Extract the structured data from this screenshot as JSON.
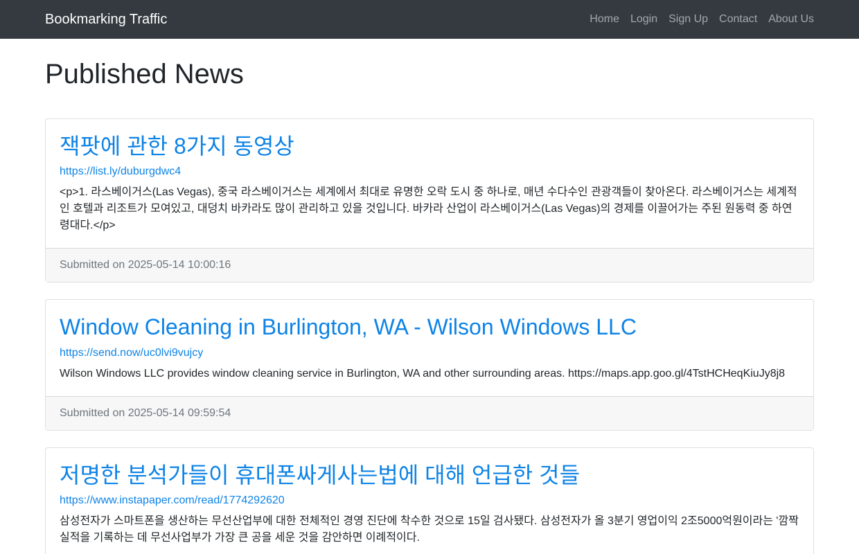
{
  "navbar": {
    "brand": "Bookmarking Traffic",
    "links": [
      "Home",
      "Login",
      "Sign Up",
      "Contact",
      "About Us"
    ]
  },
  "page_title": "Published News",
  "news": [
    {
      "title": "잭팟에 관한 8가지 동영상",
      "url": "https://list.ly/duburgdwc4",
      "description": "<p>1. 라스베이거스(Las Vegas), 중국 라스베이거스는 세계에서 최대로 유명한 오락 도시 중 하나로, 매년 수다수인 관광객들이 찾아온다. 라스베이거스는 세계적인 호텔과 리조트가 모여있고, 대덩치 바카라도 많이 관리하고 있을 것입니다. 바카라 산업이 라스베이거스(Las Vegas)의 경제를 이끌어가는 주된 원동력 중 하연령대다.</p>",
      "submitted": "Submitted on 2025-05-14 10:00:16"
    },
    {
      "title": "Window Cleaning in Burlington, WA - Wilson Windows LLC",
      "url": "https://send.now/uc0lvi9vujcy",
      "description": "Wilson Windows LLC provides window cleaning service in Burlington, WA and other surrounding areas. https://maps.app.goo.gl/4TstHCHeqKiuJy8j8",
      "submitted": "Submitted on 2025-05-14 09:59:54"
    },
    {
      "title": "저명한 분석가들이 휴대폰싸게사는법에 대해 언급한 것들",
      "url": "https://www.instapaper.com/read/1774292620",
      "description": "삼성전자가 스마트폰을 생산하는 무선산업부에 대한 전체적인 경영 진단에 착수한 것으로 15일 검사됐다. 삼성전자가 올 3분기 영업이익 2조5000억원이라는 '깜짝 실적을 기록하는 데 무선사업부가 가장 큰 공을 세운 것을 감안하면 이례적이다.",
      "submitted": ""
    }
  ]
}
